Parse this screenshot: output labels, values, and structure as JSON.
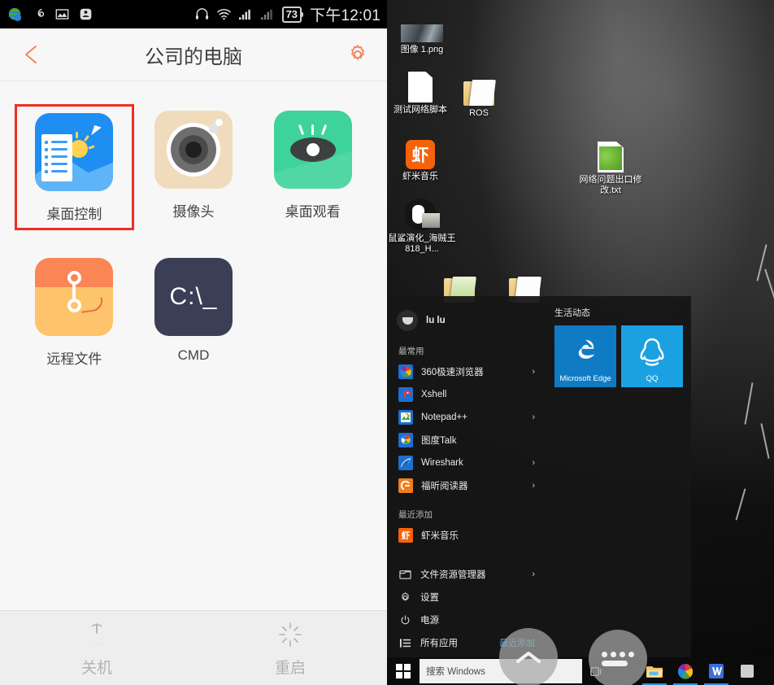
{
  "phone": {
    "statusbar": {
      "left_icons": [
        "globe-app-icon",
        "netease-music-icon",
        "gallery-icon",
        "app-icon"
      ],
      "headphone_icon": "headphone-icon",
      "wifi_icon": "wifi-icon",
      "signal1_icon": "signal-bars-icon",
      "signal2_icon": "signal-bars-icon",
      "battery_level": "73",
      "time": "下午12:01"
    },
    "appbar": {
      "back_icon": "back-arrow-icon",
      "title": "公司的电脑",
      "settings_icon": "gear-icon"
    },
    "apps": [
      {
        "label": "桌面控制",
        "icon": "desktop-control-icon",
        "selected": true
      },
      {
        "label": "摄像头",
        "icon": "camera-icon",
        "selected": false
      },
      {
        "label": "桌面观看",
        "icon": "desktop-view-eye-icon",
        "selected": false
      },
      {
        "label": "远程文件",
        "icon": "remote-file-icon",
        "selected": false
      },
      {
        "label": "CMD",
        "icon": "cmd-icon",
        "selected": false,
        "icon_text": "C:\\_"
      }
    ],
    "footer": [
      {
        "label": "关机",
        "icon": "power-icon"
      },
      {
        "label": "重启",
        "icon": "restart-icon"
      }
    ],
    "colors": {
      "accent": "#f3855a",
      "selection": "#f02d20",
      "background": "#f7f7f7"
    }
  },
  "windows": {
    "desktop_icons": [
      {
        "label": "图像 1.png",
        "icon": "image-thumbnail-icon"
      },
      {
        "label": "测试网络脚本",
        "icon": "file-icon"
      },
      {
        "label": "ROS",
        "icon": "folder-icon"
      },
      {
        "label": "虾米音乐",
        "icon": "xiami-music-icon",
        "icon_text": "虾"
      },
      {
        "label": "鼠鲨演化_海贼王818_H...",
        "icon": "mouse-shortcut-icon"
      },
      {
        "label": "网络问题出口修改.txt",
        "icon": "text-file-icon"
      }
    ],
    "start_menu": {
      "user": {
        "name": "lu lu",
        "avatar": "user-avatar-icon"
      },
      "most_used_title": "最常用",
      "most_used": [
        {
          "label": "360极速浏览器",
          "icon": "360-browser-icon",
          "has_chevron": true
        },
        {
          "label": "Xshell",
          "icon": "xshell-icon",
          "has_chevron": false
        },
        {
          "label": "Notepad++",
          "icon": "notepadpp-icon",
          "has_chevron": true
        },
        {
          "label": "图度Talk",
          "icon": "tudu-talk-icon",
          "has_chevron": false
        },
        {
          "label": "Wireshark",
          "icon": "wireshark-icon",
          "has_chevron": true
        },
        {
          "label": "福昕阅读器",
          "icon": "foxit-reader-icon",
          "has_chevron": true
        }
      ],
      "recent_title": "最近添加",
      "recent": [
        {
          "label": "虾米音乐",
          "icon": "xiami-music-icon",
          "icon_text": "虾"
        }
      ],
      "bottom": [
        {
          "label": "文件资源管理器",
          "icon": "file-explorer-icon",
          "has_chevron": true
        },
        {
          "label": "设置",
          "icon": "settings-gear-icon",
          "has_chevron": false
        },
        {
          "label": "电源",
          "icon": "power-icon",
          "has_chevron": false
        },
        {
          "label": "所有应用",
          "icon": "all-apps-icon",
          "has_chevron": false,
          "hint": "最近添加"
        }
      ],
      "tile_group_title": "生活动态",
      "tiles": [
        {
          "label": "Microsoft Edge",
          "icon": "edge-icon",
          "color": "#0f7bc4"
        },
        {
          "label": "QQ",
          "icon": "qq-penguin-icon",
          "color": "#1ba1e2"
        }
      ]
    },
    "taskbar": {
      "start_icon": "windows-start-icon",
      "search_placeholder": "搜索 Windows",
      "taskview_icon": "task-view-icon",
      "apps": [
        {
          "icon": "file-explorer-icon"
        },
        {
          "icon": "360-browser-icon"
        },
        {
          "icon": "wps-writer-icon"
        },
        {
          "icon": "app-icon"
        }
      ],
      "overlay_up_icon": "chevron-up-icon",
      "overlay_apps_icon": "app-drawer-icon"
    }
  }
}
